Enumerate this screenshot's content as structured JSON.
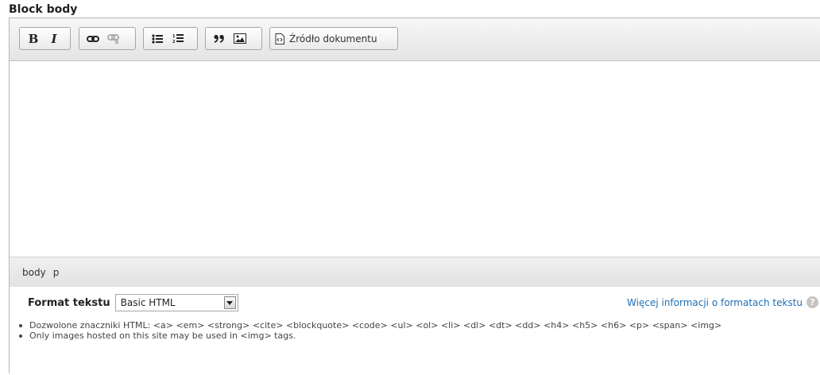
{
  "field": {
    "label": "Block body"
  },
  "toolbar": {
    "bold_label": "B",
    "italic_label": "I",
    "source_label": "Źródło dokumentu"
  },
  "path": {
    "items": [
      "body",
      "p"
    ]
  },
  "format": {
    "label": "Format tekstu",
    "selected": "Basic HTML",
    "more_info_link": "Więcej informacji o formatach tekstu",
    "help_icon": "?"
  },
  "tips": [
    "Dozwolone znaczniki HTML: <a> <em> <strong> <cite> <blockquote> <code> <ul> <ol> <li> <dl> <dt> <dd> <h4> <h5> <h6> <p> <span> <img>",
    "Only images hosted on this site may be used in <img> tags."
  ],
  "icons": {
    "bold": "bold-icon",
    "italic": "italic-icon",
    "link": "link-icon",
    "unlink": "unlink-icon",
    "bulleted_list": "bulleted-list-icon",
    "numbered_list": "numbered-list-icon",
    "blockquote": "blockquote-icon",
    "image": "image-icon",
    "source": "source-icon",
    "help": "help-icon",
    "dropdown": "chevron-down-icon"
  },
  "colors": {
    "link": "#1e6fb5",
    "toolbar_bg": "#e8e8e8",
    "border": "#b6b6b6"
  }
}
